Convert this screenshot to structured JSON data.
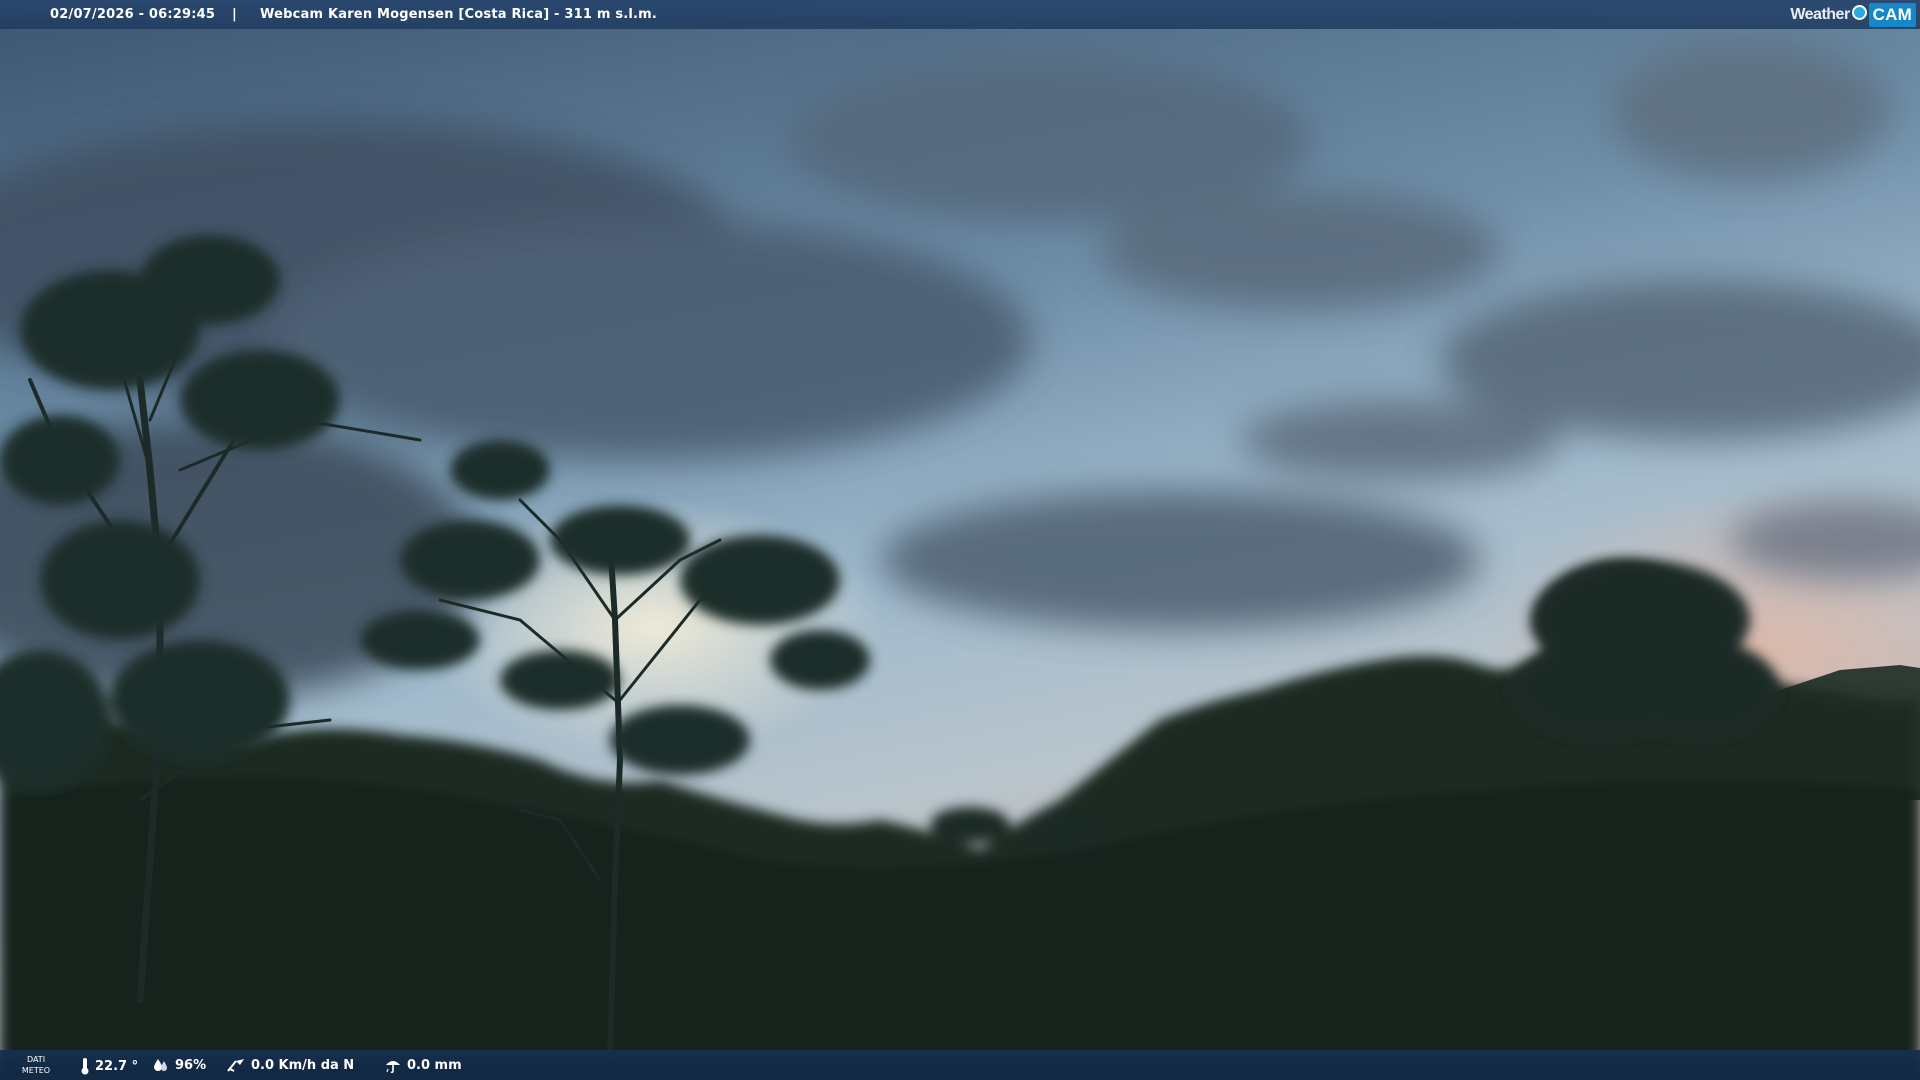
{
  "overlay": {
    "timestamp": "02/07/2026 - 06:29:45",
    "separator": "|",
    "camera_title": "Webcam Karen Mogensen [Costa Rica]  - 311 m s.l.m.",
    "logo": {
      "weather": "Weather",
      "cam": "CAM"
    }
  },
  "weather_bar": {
    "label_line1": "DATI",
    "label_line2": "METEO",
    "temperature": "22.7 °",
    "humidity": "96%",
    "wind": "0.0 Km/h da N",
    "rain": "0.0 mm"
  },
  "colors": {
    "bar": "#1e3a5f",
    "logo_accent": "#1688c9"
  },
  "icons": [
    "thermometer-icon",
    "humidity-icon",
    "wind-icon",
    "rain-icon"
  ]
}
